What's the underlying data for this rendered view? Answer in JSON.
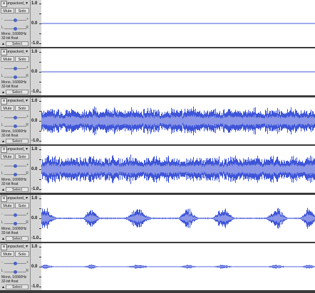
{
  "scale_labels": {
    "top": "1.0",
    "middle": "0.0",
    "bottom": "-1.0"
  },
  "colors": {
    "waveform": "#3e55d8",
    "waveform_light": "#8b97e6",
    "track_panel": "#d2d2d2",
    "selected_border": "#d4d400"
  },
  "tracks": [
    {
      "name": "unpacked_24",
      "close_icon": "×",
      "dropdown_icon": "▾",
      "mute": "Mute",
      "solo": "Solo",
      "gain_low": "-",
      "gain_high": "+",
      "pan_low": "L",
      "pan_high": "R",
      "rate": "Mono, 16000Hz",
      "format": "32-bit float",
      "collapse_icon": "▲",
      "select": "Select",
      "gain_level": 0.5,
      "pan_level": 0.5,
      "amplitude": 0.0,
      "style": "flat",
      "selected": true
    },
    {
      "name": "unpacked_24",
      "close_icon": "×",
      "dropdown_icon": "▾",
      "mute": "Mute",
      "solo": "Solo",
      "gain_low": "-",
      "gain_high": "+",
      "pan_low": "L",
      "pan_high": "R",
      "rate": "Mono, 16000Hz",
      "format": "32-bit float",
      "collapse_icon": "▲",
      "select": "Select",
      "gain_level": 0.5,
      "pan_level": 0.5,
      "amplitude": 0.0,
      "style": "flat",
      "selected": false
    },
    {
      "name": "unpacked_24",
      "close_icon": "×",
      "dropdown_icon": "▾",
      "mute": "Mute",
      "solo": "Solo",
      "gain_low": "-",
      "gain_high": "+",
      "pan_low": "L",
      "pan_high": "R",
      "rate": "Mono, 16000Hz",
      "format": "32-bit float",
      "collapse_icon": "▲",
      "select": "Select",
      "gain_level": 0.5,
      "pan_level": 0.5,
      "amplitude": 0.75,
      "style": "noise",
      "selected": false
    },
    {
      "name": "unpacked_24",
      "close_icon": "×",
      "dropdown_icon": "▾",
      "mute": "Mute",
      "solo": "Solo",
      "gain_low": "-",
      "gain_high": "+",
      "pan_low": "L",
      "pan_high": "R",
      "rate": "Mono, 16000Hz",
      "format": "32-bit float",
      "collapse_icon": "▲",
      "select": "Select",
      "gain_level": 0.5,
      "pan_level": 0.5,
      "amplitude": 0.75,
      "style": "noise",
      "selected": false
    },
    {
      "name": "unpacked_24",
      "close_icon": "×",
      "dropdown_icon": "▾",
      "mute": "Mute",
      "solo": "Solo",
      "gain_low": "-",
      "gain_high": "+",
      "pan_low": "L",
      "pan_high": "R",
      "rate": "Mono, 16000Hz",
      "format": "32-bit float",
      "collapse_icon": "▲",
      "select": "Select",
      "gain_level": 0.5,
      "pan_level": 0.5,
      "amplitude": 0.6,
      "style": "speech",
      "selected": false
    },
    {
      "name": "unpacked_24",
      "close_icon": "×",
      "dropdown_icon": "▾",
      "mute": "Mute",
      "solo": "Solo",
      "gain_low": "-",
      "gain_high": "+",
      "pan_low": "L",
      "pan_high": "R",
      "rate": "Mono, 16000Hz",
      "format": "32-bit float",
      "collapse_icon": "▲",
      "select": "Select",
      "gain_level": 0.5,
      "pan_level": 0.5,
      "amplitude": 0.12,
      "style": "speech",
      "selected": false
    }
  ]
}
